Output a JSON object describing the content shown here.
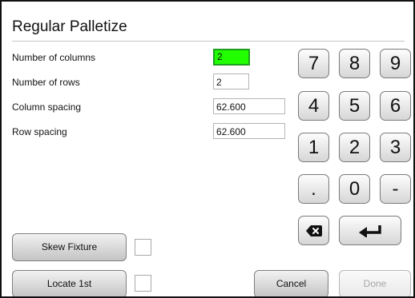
{
  "dialog": {
    "title": "Regular Palletize"
  },
  "fields": [
    {
      "label": "Number of columns",
      "value": "2"
    },
    {
      "label": "Number of rows",
      "value": "2"
    },
    {
      "label": "Column spacing",
      "value": "62.600"
    },
    {
      "label": "Row spacing",
      "value": "62.600"
    }
  ],
  "keypad": {
    "keys": [
      "7",
      "8",
      "9",
      "4",
      "5",
      "6",
      "1",
      "2",
      "3",
      ".",
      "0",
      "-"
    ],
    "backspace_icon": "backspace-icon",
    "enter_icon": "enter-return-icon"
  },
  "buttons": {
    "skew_fixture": "Skew Fixture",
    "locate_first": "Locate 1st",
    "cancel": "Cancel",
    "done": "Done"
  },
  "colors": {
    "active_field": "#22ff00"
  }
}
